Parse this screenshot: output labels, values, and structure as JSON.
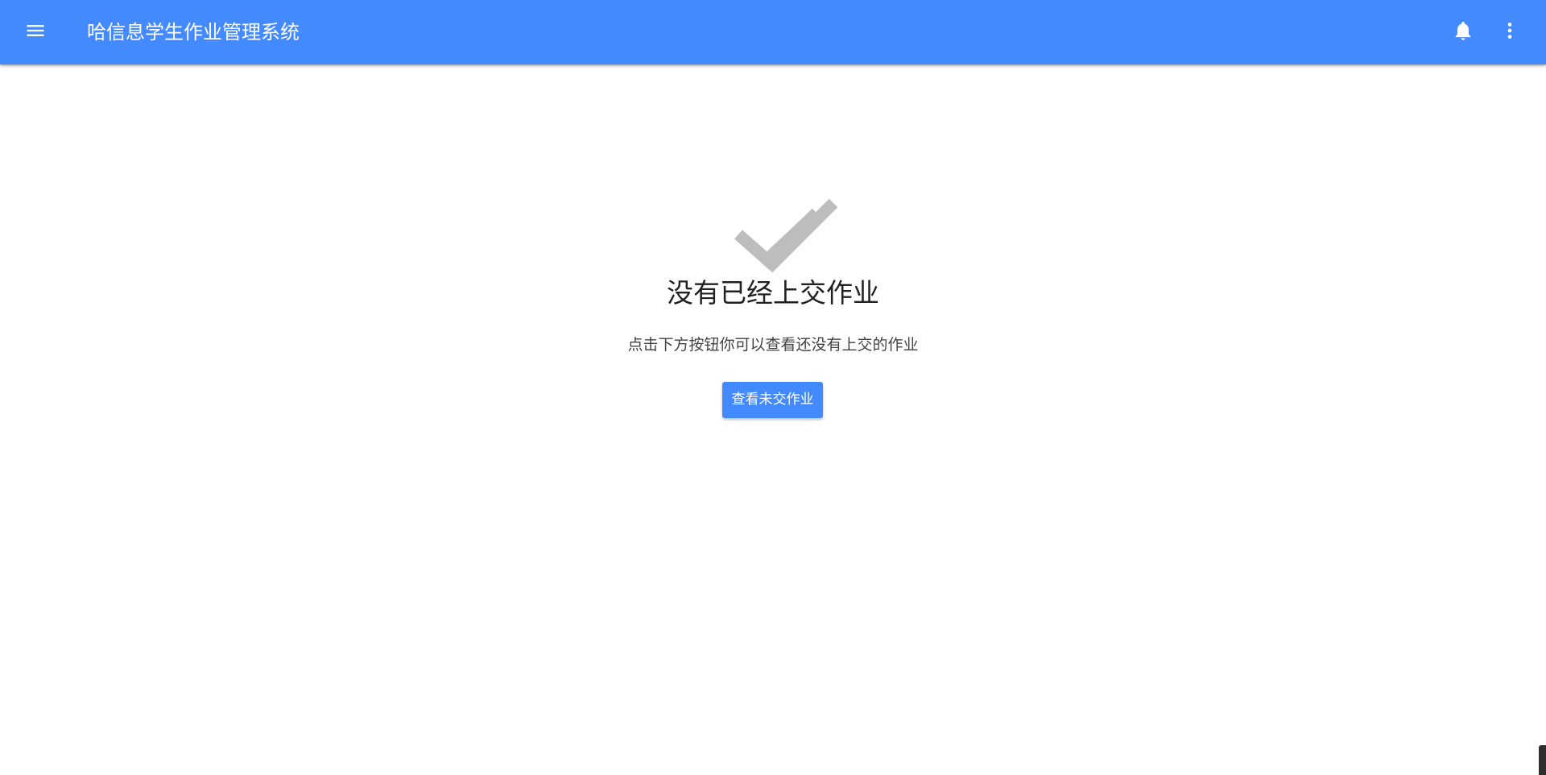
{
  "appbar": {
    "title": "哈信息学生作业管理系统",
    "menu_icon": "menu-icon",
    "bell_icon": "bell-icon",
    "more_icon": "more-vert-icon",
    "color": "#448aff"
  },
  "empty_state": {
    "icon": "done-all-icon",
    "icon_color": "#bdbdbd",
    "title": "没有已经上交作业",
    "subtitle": "点击下方按钮你可以查看还没有上交的作业",
    "button_label": "查看未交作业"
  }
}
